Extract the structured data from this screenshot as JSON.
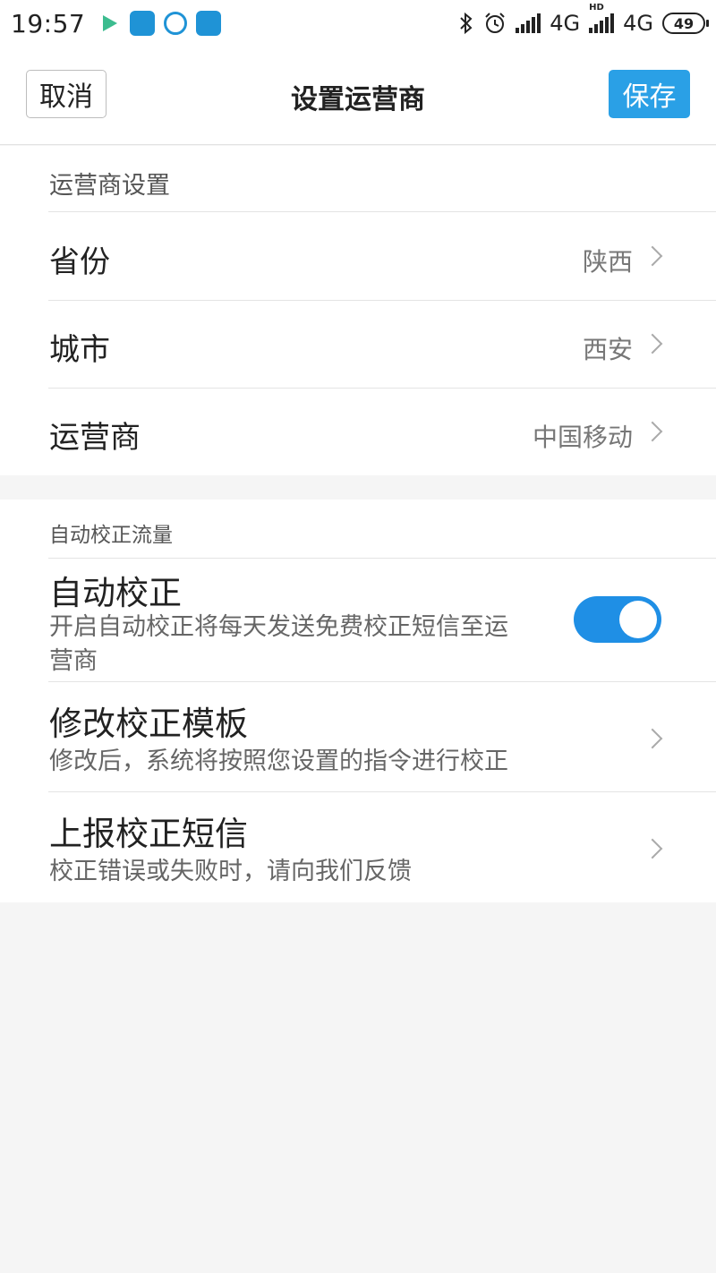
{
  "status_bar": {
    "time": "19:57",
    "network_1": "4G",
    "network_2": "4G",
    "hd_badge": "HD",
    "battery": "49",
    "icons": [
      "bluetooth-icon",
      "alarm-icon",
      "signal-icon",
      "battery-icon"
    ]
  },
  "header": {
    "cancel_label": "取消",
    "title": "设置运营商",
    "save_label": "保存"
  },
  "carrier_section": {
    "title": "运营商设置",
    "rows": [
      {
        "label": "省份",
        "value": "陕西"
      },
      {
        "label": "城市",
        "value": "西安"
      },
      {
        "label": "运营商",
        "value": "中国移动"
      }
    ]
  },
  "auto_section": {
    "title": "自动校正流量",
    "auto_correct": {
      "title": "自动校正",
      "desc_line1": "开启自动校正将每天发送免费校正短信至运",
      "desc_line2": "营商",
      "enabled": true
    },
    "modify_template": {
      "title": "修改校正模板",
      "desc": "修改后，系统将按照您设置的指令进行校正"
    },
    "report_sms": {
      "title": "上报校正短信",
      "desc": "校正错误或失败时，请向我们反馈"
    }
  },
  "colors": {
    "accent": "#2aa0e6",
    "toggle_on": "#1f8fe5",
    "background": "#f5f5f5"
  }
}
